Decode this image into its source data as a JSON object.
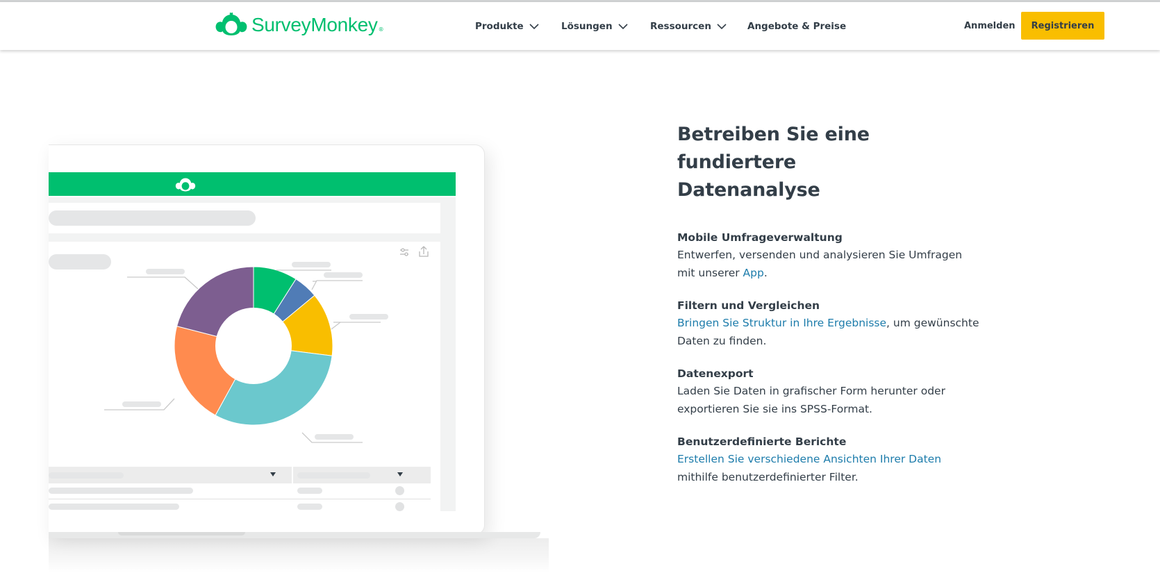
{
  "header": {
    "brand": "SurveyMonkey",
    "brand_mark": "®",
    "nav": [
      {
        "label": "Produkte",
        "has_dropdown": true
      },
      {
        "label": "Lösungen",
        "has_dropdown": true
      },
      {
        "label": "Ressourcen",
        "has_dropdown": true
      },
      {
        "label": "Angebote & Preise",
        "has_dropdown": false
      }
    ],
    "signin_label": "Anmelden",
    "signup_label": "Registrieren"
  },
  "main": {
    "headline_line1": "Betreiben Sie eine fundiertere",
    "headline_line2": "Datenanalyse",
    "features": [
      {
        "title": "Mobile Umfrageverwaltung",
        "text_before": "Entwerfen, versenden und analysieren Sie Umfragen mit unserer ",
        "link": "App",
        "text_after": "."
      },
      {
        "title": "Filtern und Vergleichen",
        "link": "Bringen Sie Struktur in Ihre Ergebnisse",
        "text_after": ", um gewünschte Daten zu finden."
      },
      {
        "title": "Datenexport",
        "text": "Laden Sie Daten in grafischer Form herunter oder exportieren Sie sie ins SPSS-Format."
      },
      {
        "title": "Benutzerdefinierte Berichte",
        "link": "Erstellen Sie verschiedene Ansichten Ihrer Daten",
        "text_after": " mithilfe benutzerdefinierter Filter."
      }
    ]
  },
  "illustration": {
    "donut_segments": [
      {
        "color": "#00bf6f",
        "share": 0.09
      },
      {
        "color": "#507cb6",
        "share": 0.05
      },
      {
        "color": "#f9be00",
        "share": 0.13
      },
      {
        "color": "#6bc8cd",
        "share": 0.31
      },
      {
        "color": "#ff8b4f",
        "share": 0.21
      },
      {
        "color": "#7d5e90",
        "share": 0.21
      }
    ]
  },
  "colors": {
    "brand_green": "#00bf6f",
    "signup_yellow": "#f9be00",
    "link_blue": "#1d7cab",
    "text_dark": "#333e48"
  },
  "icons": [
    "surveymonkey-logo-icon",
    "chevron-down-icon",
    "filter-icon",
    "share-icon",
    "dropdown-arrow-icon"
  ]
}
